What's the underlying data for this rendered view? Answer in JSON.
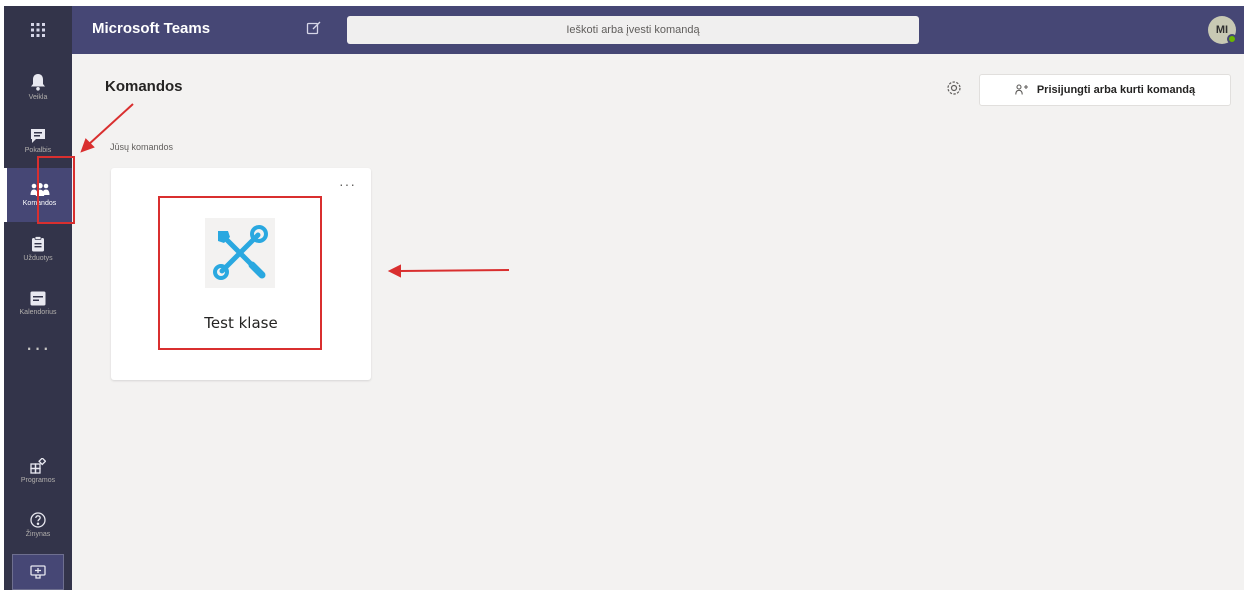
{
  "titlebar": {
    "app_title": "Microsoft Teams",
    "search_placeholder": "Ieškoti arba įvesti komandą",
    "avatar_initials": "MI"
  },
  "rail": {
    "items": [
      {
        "label": "Veikla",
        "icon": "bell-icon"
      },
      {
        "label": "Pokalbis",
        "icon": "chat-icon"
      },
      {
        "label": "Komandos",
        "icon": "teams-icon",
        "active": true
      },
      {
        "label": "Užduotys",
        "icon": "assignments-icon"
      },
      {
        "label": "Kalendorius",
        "icon": "calendar-icon"
      }
    ],
    "more": "···",
    "bottom": [
      {
        "label": "Programos",
        "icon": "apps-grid-icon"
      },
      {
        "label": "Žinynas",
        "icon": "help-icon"
      }
    ]
  },
  "main": {
    "title": "Komandos",
    "join_button": "Prisijungti arba kurti komandą",
    "section_label": "Jūsų komandos",
    "teams": [
      {
        "name": "Test klase",
        "icon": "tools-icon"
      }
    ],
    "card_more": "···"
  },
  "colors": {
    "titlebar": "#464775",
    "rail": "#33344a",
    "annotation": "#d92f2f",
    "team_icon": "#2aa8e0"
  }
}
